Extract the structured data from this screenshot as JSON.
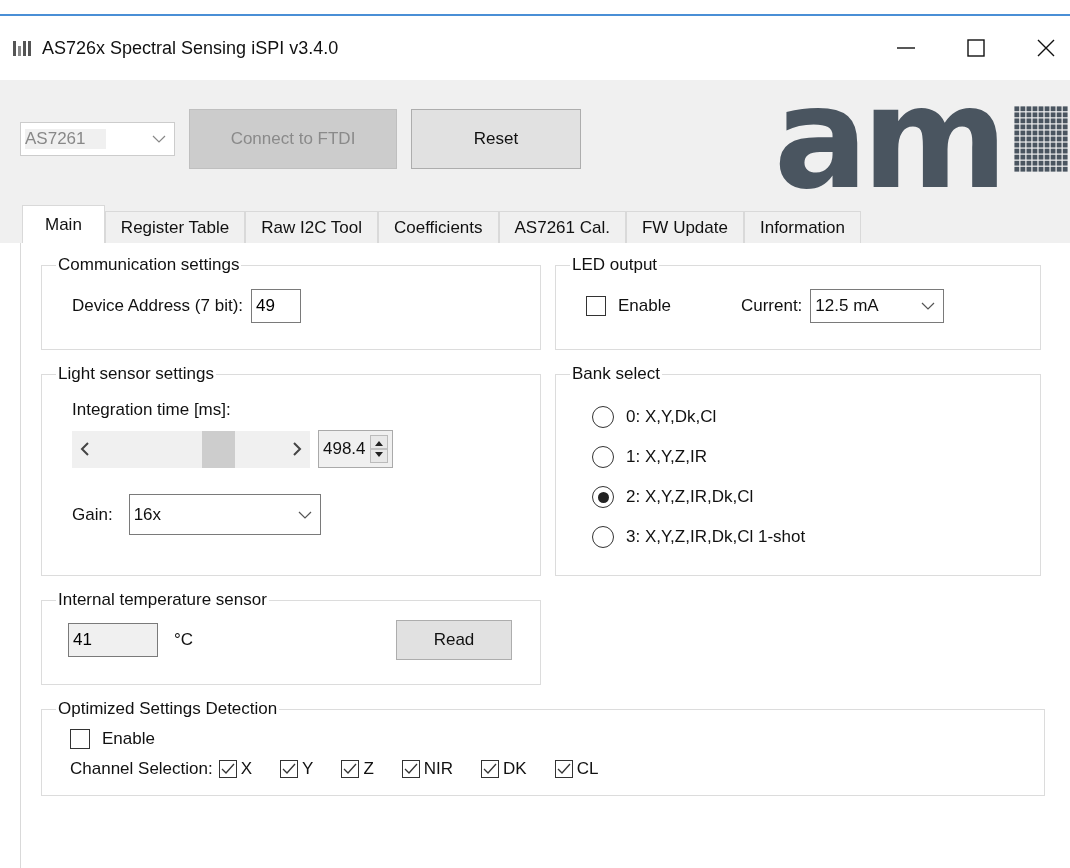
{
  "window": {
    "title": "AS726x Spectral Sensing iSPI v3.4.0"
  },
  "toolbar": {
    "device_select": {
      "value": "AS7261",
      "disabled": true
    },
    "buttons": [
      {
        "label": "Connect to FTDI",
        "disabled": true
      },
      {
        "label": "Reset",
        "disabled": false
      }
    ],
    "logo": "am"
  },
  "tabs": [
    {
      "label": "Main",
      "selected": true
    },
    {
      "label": "Register Table",
      "selected": false
    },
    {
      "label": "Raw I2C Tool",
      "selected": false
    },
    {
      "label": "Coefficients",
      "selected": false
    },
    {
      "label": "AS7261 Cal.",
      "selected": false
    },
    {
      "label": "FW Update",
      "selected": false
    },
    {
      "label": "Information",
      "selected": false
    }
  ],
  "communication": {
    "title": "Communication settings",
    "label": "Device Address (7 bit):",
    "value": "49"
  },
  "led_output": {
    "title": "LED output",
    "enable": {
      "label": "Enable",
      "checked": false
    },
    "current_label": "Current:",
    "current_value": "12.5 mA"
  },
  "light_sensor": {
    "title": "Light sensor settings",
    "integration_label": "Integration time [ms]:",
    "value": "498.4",
    "gain_label": "Gain:",
    "gain_value": "16x"
  },
  "bank_select": {
    "title": "Bank select",
    "options": [
      {
        "label": "0: X,Y,Dk,Cl",
        "selected": false
      },
      {
        "label": "1: X,Y,Z,IR",
        "selected": false
      },
      {
        "label": "2: X,Y,Z,IR,Dk,Cl",
        "selected": true
      },
      {
        "label": "3: X,Y,Z,IR,Dk,Cl 1-shot",
        "selected": false
      }
    ]
  },
  "temperature": {
    "title": "Internal temperature sensor",
    "value": "41",
    "unit": "°C",
    "button": "Read"
  },
  "optimized": {
    "title": "Optimized Settings Detection",
    "enable": {
      "label": "Enable",
      "checked": false
    },
    "channel_label": "Channel Selection:",
    "channels": [
      {
        "label": "X",
        "checked": true
      },
      {
        "label": "Y",
        "checked": true
      },
      {
        "label": "Z",
        "checked": true
      },
      {
        "label": "NIR",
        "checked": true
      },
      {
        "label": "DK",
        "checked": true
      },
      {
        "label": "CL",
        "checked": true
      }
    ]
  }
}
